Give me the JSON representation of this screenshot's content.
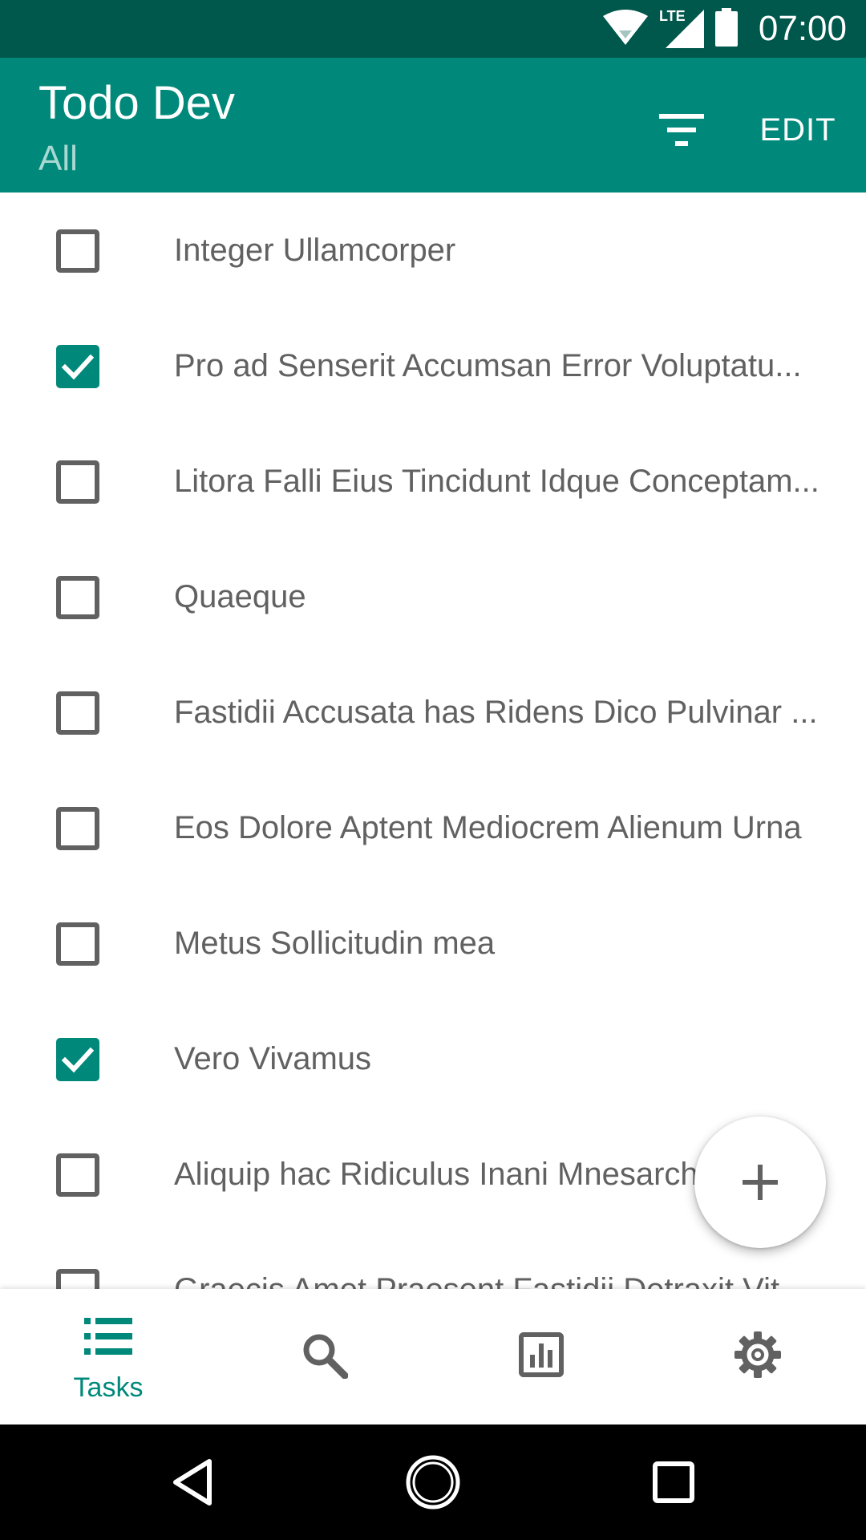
{
  "status_bar": {
    "time": "07:00",
    "network": "LTE"
  },
  "app_bar": {
    "title": "Todo Dev",
    "subtitle": "All",
    "edit_label": "EDIT"
  },
  "tasks": [
    {
      "text": "Integer Ullamcorper",
      "done": false
    },
    {
      "text": "Pro ad Senserit Accumsan Error Voluptatu...",
      "done": true
    },
    {
      "text": "Litora Falli Eius Tincidunt Idque Conceptam...",
      "done": false
    },
    {
      "text": "Quaeque",
      "done": false
    },
    {
      "text": "Fastidii Accusata has Ridens Dico Pulvinar ...",
      "done": false
    },
    {
      "text": "Eos Dolore Aptent Mediocrem Alienum Urna",
      "done": false
    },
    {
      "text": "Metus Sollicitudin mea",
      "done": false
    },
    {
      "text": "Vero Vivamus",
      "done": true
    },
    {
      "text": "Aliquip hac Ridiculus Inani Mnesarchum ...",
      "done": false
    },
    {
      "text": "Graecis Amet Praesent Fastidii Detraxit Vit...",
      "done": false
    }
  ],
  "bottom_nav": {
    "tasks_label": "Tasks"
  },
  "colors": {
    "primary": "#00897b",
    "primary_dark": "#00574b",
    "subtitle": "#a7d8d1",
    "text": "#616161"
  }
}
